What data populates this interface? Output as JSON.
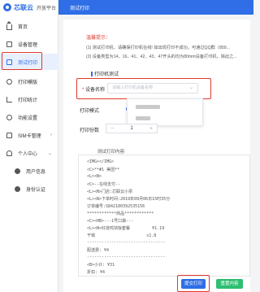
{
  "header": {
    "brand": "芯联云",
    "subtitle": "开放平台",
    "page_title": "测试打印"
  },
  "sidebar": {
    "items": [
      {
        "label": "首页",
        "icon": "home-icon"
      },
      {
        "label": "设备管理",
        "icon": "device-icon"
      },
      {
        "label": "测试打印",
        "icon": "print-icon"
      },
      {
        "label": "打印模版",
        "icon": "template-icon"
      },
      {
        "label": "打印统计",
        "icon": "chart-icon"
      },
      {
        "label": "功能设置",
        "icon": "settings-icon"
      },
      {
        "label": "SIM卡管理",
        "icon": "sim-icon"
      },
      {
        "label": "个人中心",
        "icon": "user-icon"
      },
      {
        "label": "用户信息",
        "icon": "person-icon"
      },
      {
        "label": "身份认证",
        "icon": "person-icon"
      }
    ]
  },
  "tips": {
    "title": "温馨提示：",
    "line1": "(1) 测试打印机，请确保打印机在线! 如出现打印不成功，可通过QQ群（859...",
    "line2": "(2) 设备类型为14、16、41、42、43、47开头的均为80mm设备打印机，除此之..."
  },
  "form": {
    "section_title": "打印机测试",
    "device_label": "设备名称",
    "device_placeholder": "请输入打印机设备名称",
    "mode_label": "打印模式",
    "copies_label": "打印份数",
    "copies_value": "1",
    "content_label": "测试打印内容:"
  },
  "content_lines": [
    "<IMG></IMG>",
    "<C>**#1 美团**",
    "<L><N>",
    "<C>--在线支付--",
    "<L><N>门店:芯联云小票",
    "<L><N>下单时间:2019年09月06日15时35分",
    "订单编号:S842180392535156",
    "************商品************",
    "<C><HB>---1号口袋---",
    "<L><N>红烧鸡块饭套餐         ¥1.19",
    "干锅                     x1.8",
    "--------------------------------",
    "配送费: ¥4",
    "--------------------------------",
    "<B>小计: ¥31",
    "折扣: ¥4"
  ],
  "buttons": {
    "submit": "提交打印",
    "reset": "重置内容"
  },
  "colors": {
    "brand": "#2f6ee6",
    "highlight": "#e0392f",
    "reset_button": "#2fbf71"
  }
}
